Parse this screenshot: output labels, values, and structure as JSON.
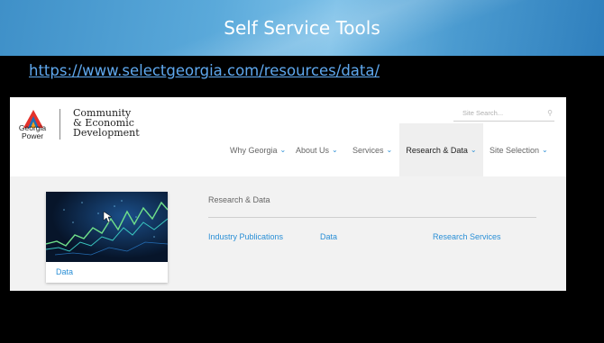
{
  "slide": {
    "title": "Self Service Tools",
    "link": "https://www.selectgeorgia.com/resources/data/"
  },
  "site": {
    "logo": {
      "company": "Georgia Power",
      "division_line1": "Community",
      "division_line2": "& Economic",
      "division_line3": "Development"
    },
    "search_placeholder": "Site Search...",
    "nav": [
      {
        "label": "Why Georgia",
        "active": false
      },
      {
        "label": "About Us",
        "active": false
      },
      {
        "label": "Services",
        "active": false
      },
      {
        "label": "Research & Data",
        "active": true
      },
      {
        "label": "Site Selection",
        "active": false
      }
    ],
    "dropdown": {
      "card_label": "Data",
      "heading": "Research & Data",
      "links": [
        "Industry Publications",
        "Data",
        "Research Services"
      ]
    }
  }
}
